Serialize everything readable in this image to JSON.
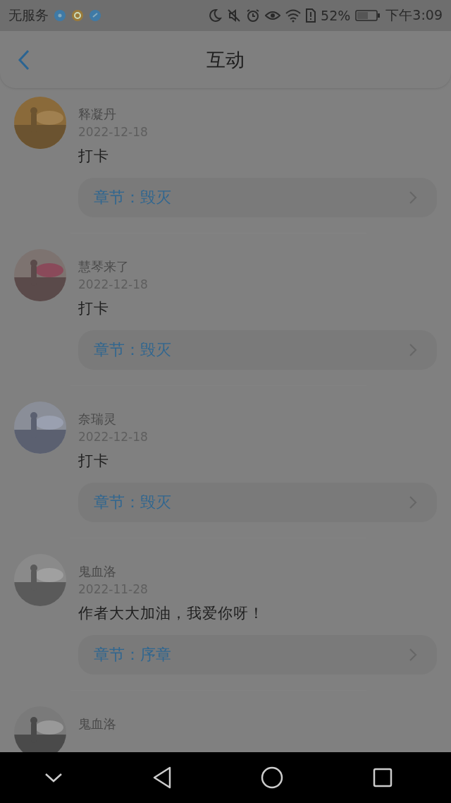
{
  "status_bar": {
    "carrier": "无服务",
    "battery_percent": "52%",
    "time": "下午3:09"
  },
  "header": {
    "title": "互动"
  },
  "comments": [
    {
      "name": "释凝丹",
      "date": "2022-12-18",
      "text": "打卡",
      "chapter": "章节：毁灭"
    },
    {
      "name": "慧琴来了",
      "date": "2022-12-18",
      "text": "打卡",
      "chapter": "章节：毁灭"
    },
    {
      "name": "奈瑞灵",
      "date": "2022-12-18",
      "text": "打卡",
      "chapter": "章节：毁灭"
    },
    {
      "name": "鬼血洛",
      "date": "2022-11-28",
      "text": "作者大大加油，我爱你呀！",
      "chapter": "章节：序章"
    },
    {
      "name": "鬼血洛"
    }
  ]
}
